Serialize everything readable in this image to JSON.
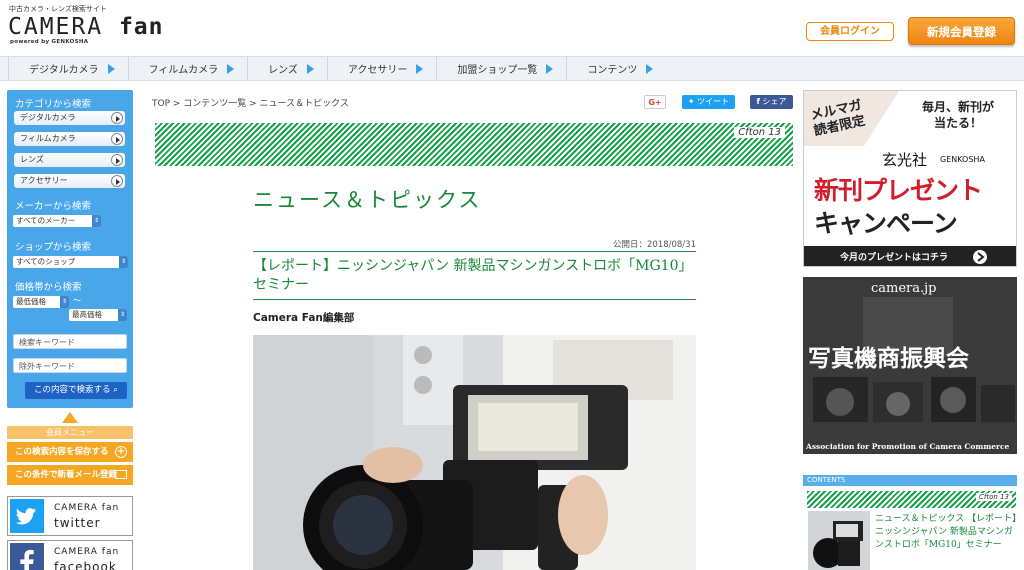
{
  "header": {
    "logo_tagline": "中古カメラ・レンズ検索サイト",
    "logo_word": "CAMERA",
    "logo_fan": "fan",
    "logo_powered": "powered by GENKOSHA",
    "login_label": "会員ログイン",
    "register_label": "新規会員登録"
  },
  "nav": {
    "items": [
      "デジタルカメラ",
      "フィルムカメラ",
      "レンズ",
      "アクセサリー",
      "加盟ショップ一覧",
      "コンテンツ"
    ]
  },
  "sidebar": {
    "category_heading": "カテゴリから検索",
    "categories": [
      "デジタルカメラ",
      "フィルムカメラ",
      "レンズ",
      "アクセサリー"
    ],
    "maker_heading": "メーカーから検索",
    "maker_select": "すべてのメーカー",
    "shop_heading": "ショップから検索",
    "shop_select": "すべてのショップ",
    "price_heading": "価格帯から検索",
    "price_min": "最低価格",
    "price_sep": "〜",
    "price_max": "最高価格",
    "keyword_placeholder": "検索キーワード",
    "exclude_placeholder": "除外キーワード",
    "search_button": "この内容で検索する"
  },
  "member": {
    "heading": "会員メニュー",
    "save_search": "この検索内容を保存する",
    "mail_register": "この条件で新着メール登録",
    "twitter_brand": "CAMERA fan",
    "twitter_label": "twitter",
    "facebook_brand": "CAMERA fan",
    "facebook_label": "facebook"
  },
  "main": {
    "breadcrumb": "TOP > コンテンツ一覧 > ニュース＆トピックス",
    "share_gplus": "G+",
    "share_tweet": "ツイート",
    "share_fb": "シェア",
    "stripe_label": "Cfton 13",
    "section_title": "ニュース＆トピックス",
    "published": "公開日：2018/08/31",
    "article_title": "【レポート】ニッシンジャパン 新製品マシンガンストロボ「MG10」セミナー",
    "author": "Camera Fan編集部"
  },
  "right": {
    "ad1_line1": "メルマガ",
    "ad1_line2": "読者限定",
    "ad1_line3": "毎月、新刊が",
    "ad1_line4": "当たる！",
    "ad1_brand": "玄光社",
    "ad1_brand_en": "GENKOSHA",
    "ad1_big1": "新刊プレゼント",
    "ad1_big2": "キャンペーン",
    "ad1_cta": "今月のプレゼントはコチラ",
    "ad2_site": "camera.jp",
    "ad2_title": "写真機商振興会",
    "ad2_en": "Association for Promotion of Camera Commerce",
    "contents_heading": "CONTENTS",
    "mini_stripe_label": "Cfton 13",
    "mini_title": "ニュース＆トピックス 【レポート】ニッシンジャパン 新製品マシンガンストロボ「MG10」セミナー"
  },
  "colors": {
    "accent_blue": "#49a6e8",
    "accent_orange": "#f5a623",
    "accent_green": "#17873a",
    "twitter": "#1da1f2",
    "facebook": "#3b5998"
  }
}
